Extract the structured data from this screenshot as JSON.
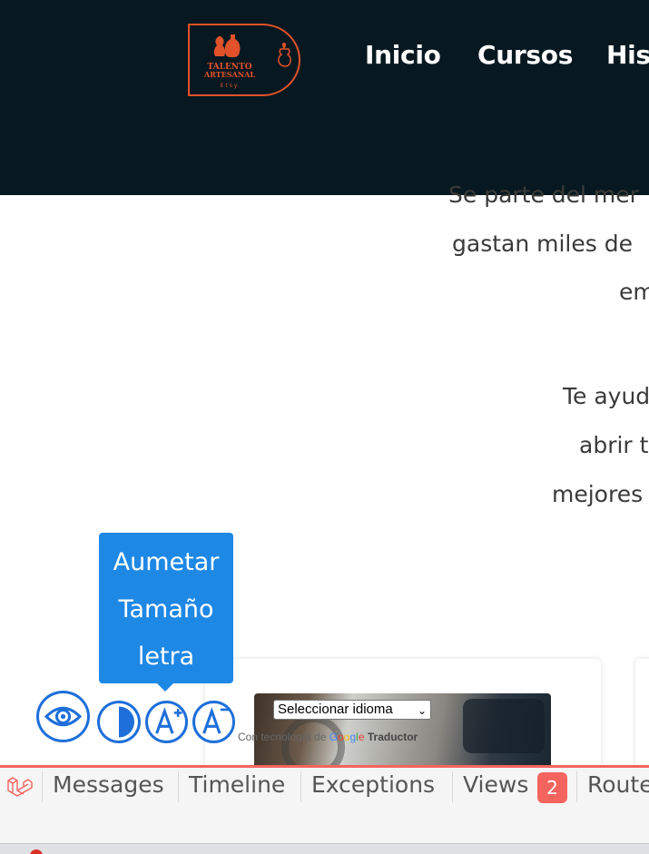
{
  "header": {
    "logo_text_1": "TALENTO",
    "logo_text_2": "ARTESANAL",
    "logo_text_3": "Etsy",
    "brand_color": "#e1522a",
    "background": "#071820",
    "nav": [
      {
        "label": "Inicio"
      },
      {
        "label": "Cursos"
      },
      {
        "label": "Hist"
      }
    ]
  },
  "content": {
    "lines": [
      "Se parte del mer",
      "gastan miles de",
      "em",
      "Te ayud",
      "abrir t",
      "mejores"
    ]
  },
  "accessibility": {
    "tooltip_lines": [
      "Aumetar",
      "Tamaño",
      "letra"
    ],
    "buttons": [
      {
        "icon": "eye-icon"
      },
      {
        "icon": "contrast-icon"
      },
      {
        "icon": "font-increase-icon"
      },
      {
        "icon": "font-decrease-icon"
      }
    ],
    "accent": "#1e6fd9"
  },
  "translate": {
    "select_value": "Seleccionar idioma",
    "powered_prefix": "Con tecnología de",
    "powered_product": "Traductor"
  },
  "debugbar": {
    "tabs": [
      {
        "label": "Messages"
      },
      {
        "label": "Timeline"
      },
      {
        "label": "Exceptions"
      },
      {
        "label": "Views"
      },
      {
        "label": "Route"
      }
    ],
    "views_badge": "2",
    "accent": "#f4645f"
  }
}
